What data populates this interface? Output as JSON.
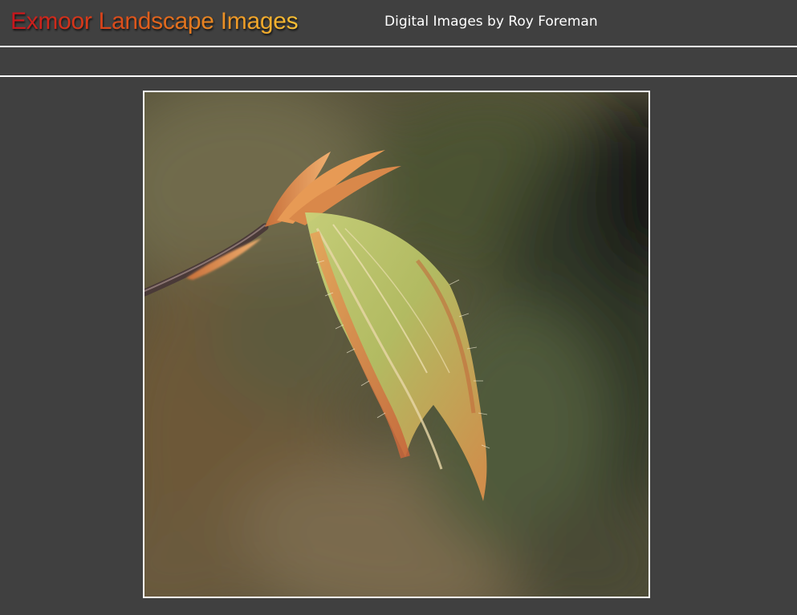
{
  "header": {
    "title": "Exmoor Landscape Images",
    "subtitle": "Digital Images by Roy Foreman"
  },
  "colors": {
    "background": "#404040",
    "rule": "#ffffff",
    "title_gradient_start": "#c8141c",
    "title_gradient_end": "#f7bf34"
  },
  "main": {
    "photo": {
      "icon": "leaf-bud-photo"
    }
  }
}
